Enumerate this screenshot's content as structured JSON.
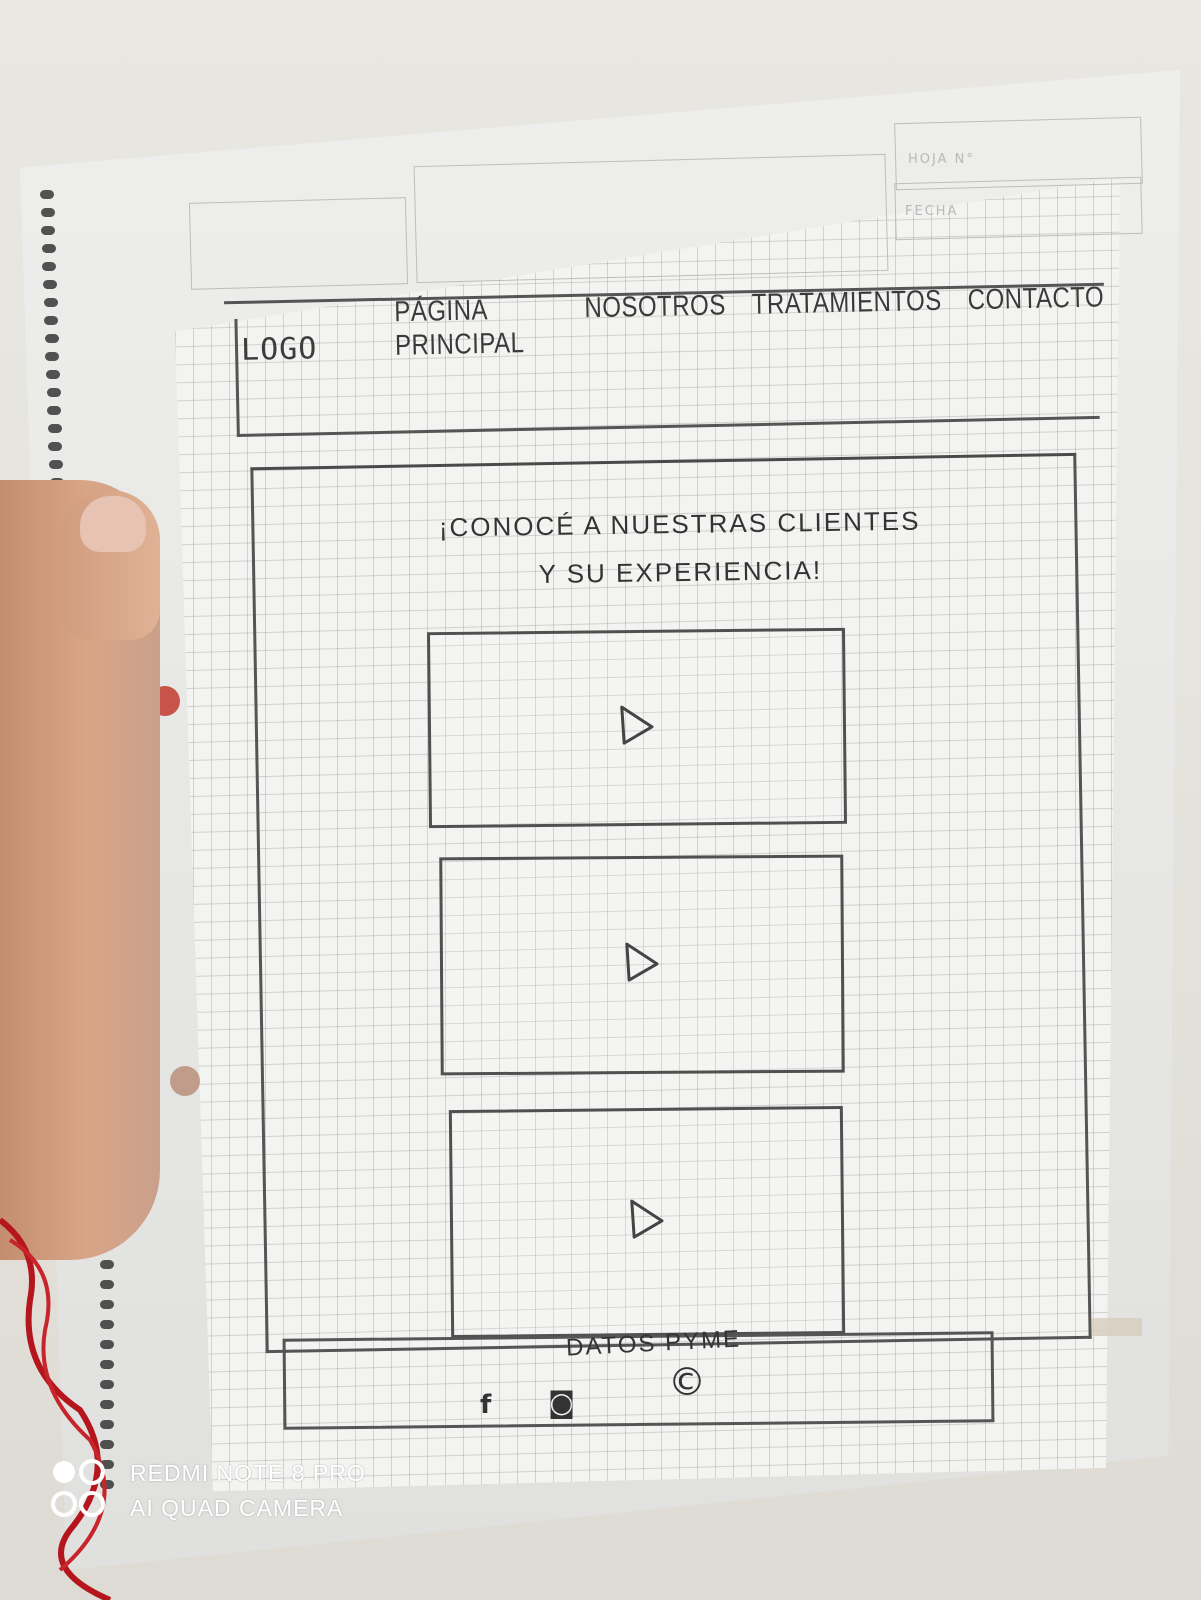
{
  "form": {
    "sheet_label": "HOJA N°",
    "date_label": "FECHA"
  },
  "wireframe": {
    "logo": "LOGO",
    "nav": [
      "PÁGINA PRINCIPAL",
      "NOSOTROS",
      "TRATAMIENTOS",
      "CONTACTO"
    ],
    "headline_line1": "¡CONOCÉ A NUESTRAS CLIENTES",
    "headline_line2": "Y SU EXPERIENCIA!",
    "videos": [
      {
        "icon": "play-icon"
      },
      {
        "icon": "play-icon"
      },
      {
        "icon": "play-icon"
      }
    ],
    "footer": {
      "title": "DATOS PYME",
      "social": [
        {
          "icon": "facebook-icon",
          "glyph": "f"
        },
        {
          "icon": "instagram-icon",
          "glyph": "◙"
        },
        {
          "icon": "whatsapp-icon",
          "glyph": "©"
        }
      ]
    }
  },
  "watermark": {
    "line1": "REDMI NOTE 8 PRO",
    "line2": "AI QUAD CAMERA"
  }
}
